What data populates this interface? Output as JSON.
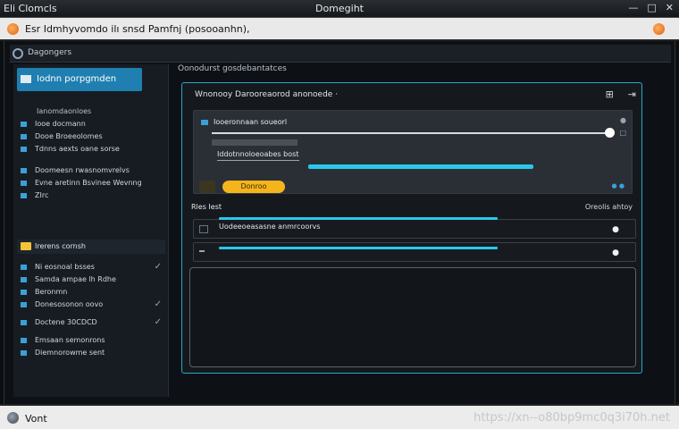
{
  "window": {
    "app_menu": "Eli  Clomcls",
    "title": "Domegiht",
    "controls": [
      "—",
      "□",
      "✕"
    ]
  },
  "address_bar": {
    "text": "Esr Idmhyvomdo ilı snsd Pamfnj (posooanhn),"
  },
  "app_header": {
    "label": "Dagongers"
  },
  "sidebar": {
    "active_item": "Iodnn porpgmden",
    "section1": {
      "heading": "Ianomdaonloes",
      "items": [
        {
          "label": "Iooe docmann",
          "icon": "doc-icon"
        },
        {
          "label": "Dooe Broeeolomes",
          "icon": "doc-icon"
        },
        {
          "label": "Tdnns aexts oane sorse",
          "icon": "doc-icon"
        }
      ]
    },
    "section2": {
      "items": [
        {
          "label": "Doomeesn rwasnomvrelvs",
          "icon": "doc-icon"
        },
        {
          "label": "Evne aretinn Bsvinee Wevnng",
          "icon": "doc-icon"
        },
        {
          "label": "ZIrc",
          "icon": "doc-icon"
        }
      ]
    },
    "folder": {
      "label": "Irerens cornsh"
    },
    "section3": {
      "items": [
        {
          "label": "Ni eosnoal bsses",
          "check": "✓"
        },
        {
          "label": "Samda ampae lh Rdhe",
          "check": ""
        },
        {
          "label": "Beronmn",
          "check": ""
        },
        {
          "label": "Donesosonon oovo",
          "check": "✓"
        },
        {
          "label": "Doctene  30CDCD",
          "check": "✓"
        },
        {
          "label": "Emsaan semonrons",
          "check": ""
        },
        {
          "label": "Diemnorowme sent",
          "check": ""
        }
      ]
    }
  },
  "content": {
    "heading": "Oonodurst gosdebantatces",
    "panel": {
      "title": "Wnonooy Darooreaorod anonoede  ·",
      "card": {
        "row1": "Iooeronnaan soueorl",
        "row3": "Iddotnnoloeoabes bost",
        "button_label": "Donroo",
        "slider_value": 1.0,
        "progress_value": 0.6
      },
      "list": {
        "head_left": "Rles  Iest",
        "head_right": "Oreolis  ahtoy",
        "rows": [
          {
            "label": "Uodeeoeasasne anmrcoorvs",
            "progress": 0.65
          },
          {
            "label": "",
            "progress": 0.65
          }
        ]
      }
    }
  },
  "statusbar": {
    "text": "Vont",
    "watermark": "https://xn--o80bp9mc0q3i70h.net"
  }
}
